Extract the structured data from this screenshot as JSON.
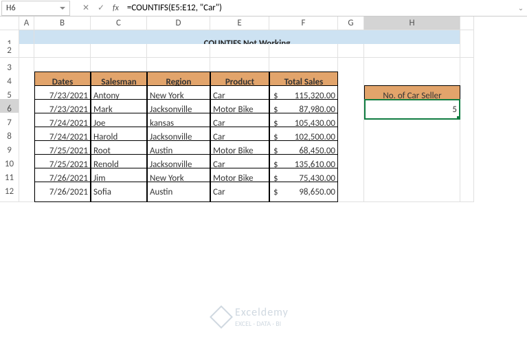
{
  "namebox": {
    "value": "H6"
  },
  "formula_bar": {
    "cancel": "✕",
    "confirm": "✓",
    "fx": "fx",
    "formula": "=COUNTIFS(E5:E12, \"Car\")"
  },
  "cols": [
    "A",
    "B",
    "C",
    "D",
    "E",
    "F",
    "G",
    "H",
    ""
  ],
  "rows": [
    "1",
    "2",
    "3",
    "4",
    "5",
    "6",
    "7",
    "8",
    "9",
    "10",
    "11",
    "12"
  ],
  "title": "COUNTIFS Not Working",
  "table": {
    "headers": [
      "Dates",
      "Salesman",
      "Region",
      "Product",
      "Total Sales"
    ],
    "rows": [
      {
        "date": "7/23/2021",
        "sales": "Antony",
        "region": "New York",
        "product": "Car",
        "total": "$ 115,320.00"
      },
      {
        "date": "7/23/2021",
        "sales": "Mark",
        "region": "Jacksonville",
        "product": "Motor Bike",
        "total": "$  87,980.00"
      },
      {
        "date": "7/24/2021",
        "sales": "Joe",
        "region": "kansas",
        "product": "Car",
        "total": "$ 105,430.00"
      },
      {
        "date": "7/24/2021",
        "sales": "Harold",
        "region": "Jacksonville",
        "product": "Car",
        "total": "$ 102,500.00"
      },
      {
        "date": "7/25/2021",
        "sales": "Root",
        "region": "Austin",
        "product": "Motor Bike",
        "total": "$  68,450.00"
      },
      {
        "date": "7/25/2021",
        "sales": "Renold",
        "region": "Jacksonville",
        "product": "Car",
        "total": "$ 135,610.00"
      },
      {
        "date": "7/26/2021",
        "sales": "Jim",
        "region": "New York",
        "product": "Motor Bike",
        "total": "$  75,430.00"
      },
      {
        "date": "7/26/2021",
        "sales": "Sofia",
        "region": "Austin",
        "product": "Car",
        "total": "$  98,650.00"
      }
    ]
  },
  "side": {
    "label": "No. of Car Seller",
    "value": "5"
  },
  "watermark": {
    "brand": "Exceldemy",
    "tag": "EXCEL · DATA · BI"
  }
}
